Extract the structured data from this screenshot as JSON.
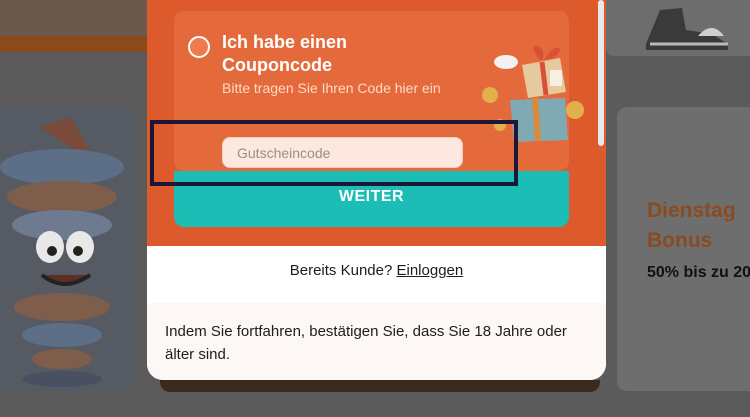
{
  "coupon": {
    "title": "Ich habe einen Couponcode",
    "subtitle": "Bitte tragen Sie Ihren Code hier ein",
    "input_placeholder": "Gutscheincode",
    "input_value": ""
  },
  "actions": {
    "continue_label": "WEITER"
  },
  "login": {
    "prompt": "Bereits Kunde?",
    "link_label": "Einloggen"
  },
  "legal": {
    "text": "Indem Sie fortfahren, bestätigen Sie, dass Sie 18 Jahre oder älter sind."
  },
  "background_promo": {
    "title": "Dienstag\nBonus",
    "subtitle": "50% bis zu 20"
  },
  "colors": {
    "accent_orange": "#dc5a2b",
    "card_orange": "#e56a3b",
    "teal_button": "#1bbdb5",
    "highlight_border": "#1c1638"
  },
  "icons": {
    "radio": "radio-unselected-icon",
    "gift": "gift-box-icon"
  }
}
